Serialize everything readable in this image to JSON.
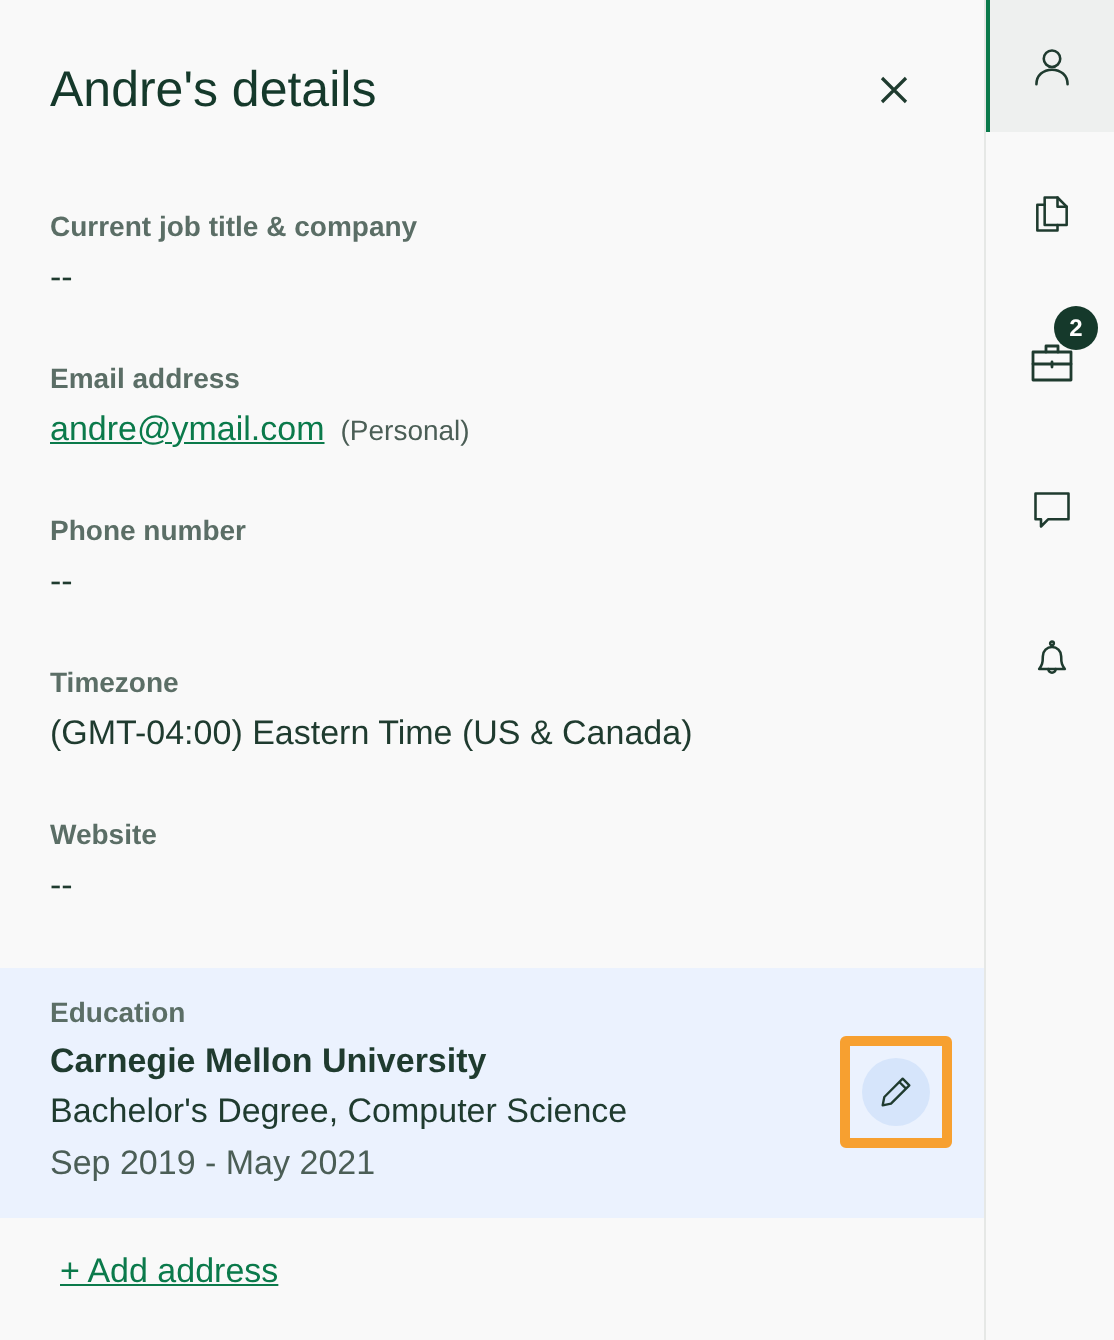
{
  "panel": {
    "title": "Andre's details"
  },
  "fields": [
    {
      "kind": "text",
      "label": "Current job title & company",
      "value": "--"
    },
    {
      "kind": "link",
      "label": "Email address",
      "value": "andre@ymail.com",
      "note": "(Personal)"
    },
    {
      "kind": "text",
      "label": "Phone number",
      "value": "--"
    },
    {
      "kind": "text",
      "label": "Timezone",
      "value": "(GMT-04:00) Eastern Time (US & Canada)"
    },
    {
      "kind": "text",
      "label": "Website",
      "value": "--"
    }
  ],
  "education": {
    "label": "Education",
    "school": "Carnegie Mellon University",
    "degree": "Bachelor's Degree, Computer Science",
    "dates": "Sep 2019 - May 2021",
    "edit_highlighted": true
  },
  "add_link": "+ Add address",
  "sidebar": [
    {
      "kind": "person",
      "selected": true
    },
    {
      "kind": "documents",
      "selected": false
    },
    {
      "kind": "briefcase",
      "selected": false,
      "badge": "2"
    },
    {
      "kind": "chat",
      "selected": false
    },
    {
      "kind": "bell",
      "selected": false
    }
  ]
}
